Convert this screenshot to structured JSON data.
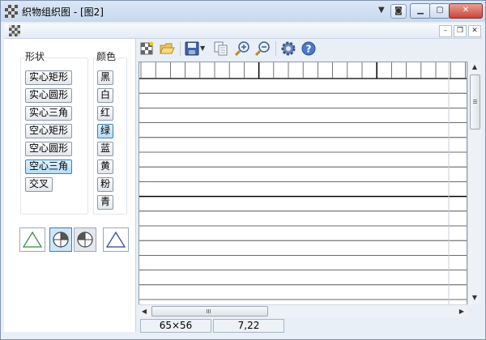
{
  "window": {
    "title": "织物组织图 - [图2]"
  },
  "left_panel": {
    "shape_label": "形状",
    "color_label": "颜色",
    "shapes": [
      {
        "label": "实心矩形",
        "selected": false
      },
      {
        "label": "实心圆形",
        "selected": false
      },
      {
        "label": "实心三角",
        "selected": false
      },
      {
        "label": "空心矩形",
        "selected": false
      },
      {
        "label": "空心圆形",
        "selected": false
      },
      {
        "label": "空心三角",
        "selected": true
      },
      {
        "label": "交叉",
        "selected": false
      }
    ],
    "colors": [
      {
        "label": "黑",
        "selected": false
      },
      {
        "label": "白",
        "selected": false
      },
      {
        "label": "红",
        "selected": false
      },
      {
        "label": "绿",
        "selected": true
      },
      {
        "label": "蓝",
        "selected": false
      },
      {
        "label": "黄",
        "selected": false
      },
      {
        "label": "粉",
        "selected": false
      },
      {
        "label": "青",
        "selected": false
      }
    ],
    "previews": [
      {
        "icon": "triangle-outline-icon",
        "color": "#2e8b3a"
      },
      {
        "icon": "circle-quadrant-icon",
        "selected": true
      },
      {
        "icon": "circle-quadrant-icon",
        "selected": false
      },
      {
        "icon": "triangle-outline-icon",
        "color": "#2b3f9e"
      }
    ]
  },
  "toolbar": {
    "tools": [
      "new-pattern-icon",
      "open-folder-icon",
      "save-icon",
      "save-dropdown-icon",
      "copy-icon",
      "zoom-in-icon",
      "zoom-out-icon",
      "settings-gear-icon",
      "help-icon"
    ]
  },
  "status": {
    "grid_size": "65×56",
    "cursor_pos": "7,22"
  },
  "colors": {
    "accent": "#3c7fb1",
    "grid_line": "#c9ced6",
    "grid_major": "#000000"
  }
}
